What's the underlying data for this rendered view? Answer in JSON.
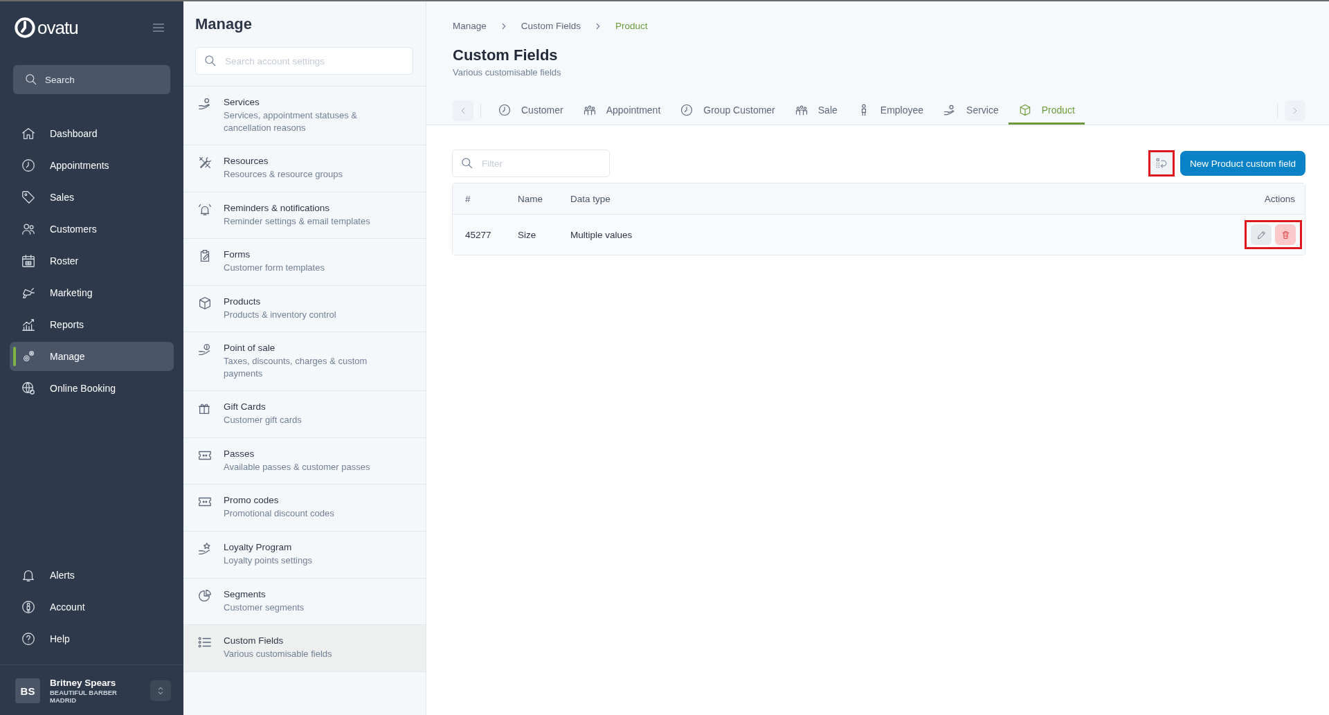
{
  "sidebar": {
    "logo": "ovatu",
    "search": {
      "placeholder": "Search"
    },
    "nav": [
      {
        "label": "Dashboard",
        "selected": false
      },
      {
        "label": "Appointments",
        "selected": false
      },
      {
        "label": "Sales",
        "selected": false
      },
      {
        "label": "Customers",
        "selected": false
      },
      {
        "label": "Roster",
        "selected": false
      },
      {
        "label": "Marketing",
        "selected": false
      },
      {
        "label": "Reports",
        "selected": false
      },
      {
        "label": "Manage",
        "selected": true
      },
      {
        "label": "Online Booking",
        "selected": false
      }
    ],
    "bottom_nav": [
      {
        "label": "Alerts"
      },
      {
        "label": "Account"
      },
      {
        "label": "Help"
      }
    ],
    "user": {
      "initials": "BS",
      "name": "Britney Spears",
      "business": "BEAUTIFUL BARBER MADRID"
    }
  },
  "settings_panel": {
    "title": "Manage",
    "search": {
      "placeholder": "Search account settings"
    },
    "items": [
      {
        "title": "Services",
        "description": "Services, appointment statuses & cancellation reasons",
        "selected": false
      },
      {
        "title": "Resources",
        "description": "Resources & resource groups",
        "selected": false
      },
      {
        "title": "Reminders & notifications",
        "description": "Reminder settings & email templates",
        "selected": false
      },
      {
        "title": "Forms",
        "description": "Customer form templates",
        "selected": false
      },
      {
        "title": "Products",
        "description": "Products & inventory control",
        "selected": false
      },
      {
        "title": "Point of sale",
        "description": "Taxes, discounts, charges & custom payments",
        "selected": false
      },
      {
        "title": "Gift Cards",
        "description": "Customer gift cards",
        "selected": false
      },
      {
        "title": "Passes",
        "description": "Available passes & customer passes",
        "selected": false
      },
      {
        "title": "Promo codes",
        "description": "Promotional discount codes",
        "selected": false
      },
      {
        "title": "Loyalty Program",
        "description": "Loyalty points settings",
        "selected": false
      },
      {
        "title": "Segments",
        "description": "Customer segments",
        "selected": false
      },
      {
        "title": "Custom Fields",
        "description": "Various customisable fields",
        "selected": true
      }
    ]
  },
  "main": {
    "breadcrumb": [
      "Manage",
      "Custom Fields",
      "Product"
    ],
    "title": "Custom Fields",
    "subtitle": "Various customisable fields",
    "tabs": [
      {
        "label": "Customer",
        "selected": false
      },
      {
        "label": "Appointment",
        "selected": false
      },
      {
        "label": "Group Customer",
        "selected": false
      },
      {
        "label": "Sale",
        "selected": false
      },
      {
        "label": "Employee",
        "selected": false
      },
      {
        "label": "Service",
        "selected": false
      },
      {
        "label": "Product",
        "selected": true
      }
    ],
    "filter": {
      "placeholder": "Filter"
    },
    "reorder_button": {
      "highlighted": true
    },
    "new_button": "New Product custom field",
    "table": {
      "columns": [
        "#",
        "Name",
        "Data type",
        "Actions"
      ],
      "rows": [
        {
          "cells": [
            "45277",
            "Size",
            "Multiple values"
          ],
          "actions_highlighted": true
        }
      ]
    }
  }
}
